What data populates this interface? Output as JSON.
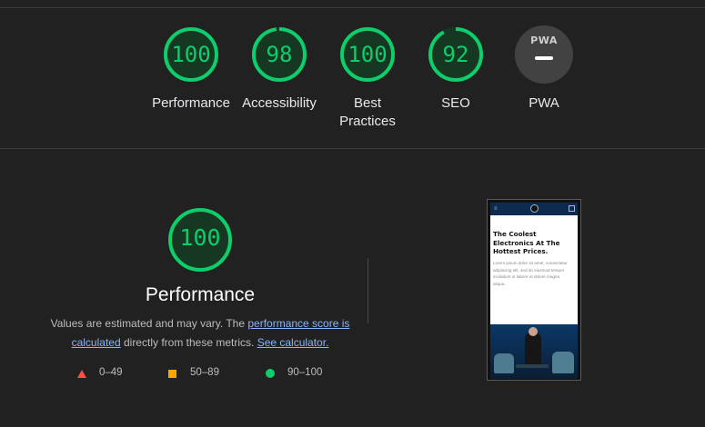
{
  "categories": [
    {
      "score": "100",
      "label": "Performance",
      "fraction": 1.0
    },
    {
      "score": "98",
      "label": "Accessibility",
      "fraction": 0.98
    },
    {
      "score": "100",
      "label": "Best\nPractices",
      "fraction": 1.0
    },
    {
      "score": "92",
      "label": "SEO",
      "fraction": 0.92
    }
  ],
  "pwa": {
    "badge_text": "PWA",
    "label": "PWA"
  },
  "performance": {
    "score": "100",
    "title": "Performance",
    "desc_prefix": "Values are estimated and may vary. The ",
    "link1": "performance score is calculated",
    "desc_middle": " directly from these metrics. ",
    "link2": "See calculator."
  },
  "legend": [
    {
      "range": "0–49",
      "shape": "triangle",
      "color": "#ff4e42"
    },
    {
      "range": "50–89",
      "shape": "square",
      "color": "#ffa400"
    },
    {
      "range": "90–100",
      "shape": "circle",
      "color": "#0cce6b"
    }
  ],
  "screenshot": {
    "heading": "The Coolest Electronics At The Hottest Prices.",
    "body": "Lorem ipsum dolor sit amet, consectetur adipiscing elit, sed do eiusmod tempor incididunt ut labore et dolore magna aliqua."
  },
  "colors": {
    "pass": "#0cce6b",
    "average": "#ffa400",
    "fail": "#ff4e42",
    "link": "#8ab4f8",
    "background": "#212121"
  }
}
